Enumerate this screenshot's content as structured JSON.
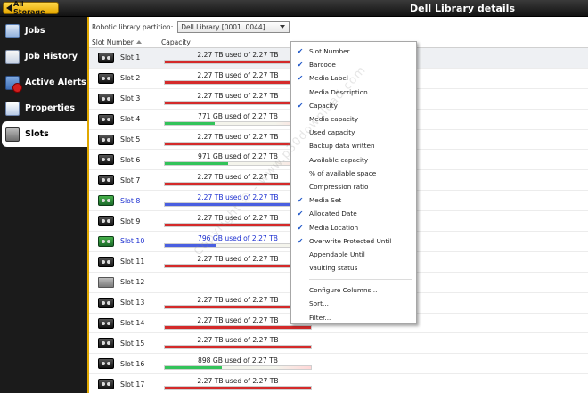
{
  "topbar": {
    "all_storage_label": "All Storage",
    "title": "Dell Library details"
  },
  "nav": {
    "items": [
      {
        "label": "Jobs",
        "icon": "jobs-icon"
      },
      {
        "label": "Job History",
        "icon": "job-history-icon"
      },
      {
        "label": "Active Alerts",
        "icon": "alert-icon"
      },
      {
        "label": "Properties",
        "icon": "properties-icon"
      },
      {
        "label": "Slots",
        "icon": "slots-icon",
        "active": true
      }
    ]
  },
  "toolbar": {
    "partition_label": "Robotic library partition:",
    "partition_value": "Dell Library [0001..0044]"
  },
  "columns": {
    "slot_number": "Slot Number",
    "capacity": "Capacity"
  },
  "rows": [
    {
      "slot": "Slot 1",
      "capacity": "2.27 TB used of 2.27 TB",
      "used_fraction": 1.0,
      "state": "full",
      "media": "tape"
    },
    {
      "slot": "Slot 2",
      "capacity": "2.27 TB used of 2.27 TB",
      "used_fraction": 1.0,
      "state": "full",
      "media": "tape"
    },
    {
      "slot": "Slot 3",
      "capacity": "2.27 TB used of 2.27 TB",
      "used_fraction": 1.0,
      "state": "full",
      "media": "tape"
    },
    {
      "slot": "Slot 4",
      "capacity": "771 GB used of 2.27 TB",
      "used_fraction": 0.34,
      "state": "partial",
      "media": "tape"
    },
    {
      "slot": "Slot 5",
      "capacity": "2.27 TB used of 2.27 TB",
      "used_fraction": 1.0,
      "state": "full",
      "media": "tape"
    },
    {
      "slot": "Slot 6",
      "capacity": "971 GB used of 2.27 TB",
      "used_fraction": 0.43,
      "state": "partial",
      "media": "tape"
    },
    {
      "slot": "Slot 7",
      "capacity": "2.27 TB used of 2.27 TB",
      "used_fraction": 1.0,
      "state": "full",
      "media": "tape"
    },
    {
      "slot": "Slot 8",
      "capacity": "2.27 TB used of 2.27 TB",
      "used_fraction": 1.0,
      "state": "online",
      "media": "tape-online"
    },
    {
      "slot": "Slot 9",
      "capacity": "2.27 TB used of 2.27 TB",
      "used_fraction": 1.0,
      "state": "full",
      "media": "tape"
    },
    {
      "slot": "Slot 10",
      "capacity": "796 GB used of 2.27 TB",
      "used_fraction": 0.35,
      "state": "online",
      "media": "tape-online"
    },
    {
      "slot": "Slot 11",
      "capacity": "2.27 TB used of 2.27 TB",
      "used_fraction": 1.0,
      "state": "full",
      "media": "tape"
    },
    {
      "slot": "Slot 12",
      "capacity": "",
      "used_fraction": 0,
      "state": "empty",
      "media": "empty"
    },
    {
      "slot": "Slot 13",
      "capacity": "2.27 TB used of 2.27 TB",
      "used_fraction": 1.0,
      "state": "full",
      "media": "tape"
    },
    {
      "slot": "Slot 14",
      "capacity": "2.27 TB used of 2.27 TB",
      "used_fraction": 1.0,
      "state": "full",
      "media": "tape"
    },
    {
      "slot": "Slot 15",
      "capacity": "2.27 TB used of 2.27 TB",
      "used_fraction": 1.0,
      "state": "full",
      "media": "tape"
    },
    {
      "slot": "Slot 16",
      "capacity": "898 GB used of 2.27 TB",
      "used_fraction": 0.39,
      "state": "partial",
      "media": "tape"
    },
    {
      "slot": "Slot 17",
      "capacity": "2.27 TB used of 2.27 TB",
      "used_fraction": 1.0,
      "state": "full",
      "media": "tape"
    }
  ],
  "context_menu": {
    "items": [
      {
        "label": "Slot Number",
        "checked": true
      },
      {
        "label": "Barcode",
        "checked": true
      },
      {
        "label": "Media Label",
        "checked": true
      },
      {
        "label": "Media Description",
        "checked": false
      },
      {
        "label": "Capacity",
        "checked": true
      },
      {
        "label": "Media capacity",
        "checked": false
      },
      {
        "label": "Used capacity",
        "checked": false
      },
      {
        "label": "Backup data written",
        "checked": false
      },
      {
        "label": "Available capacity",
        "checked": false
      },
      {
        "label": "% of available space",
        "checked": false
      },
      {
        "label": "Compression ratio",
        "checked": false
      },
      {
        "label": "Media Set",
        "checked": true
      },
      {
        "label": "Allocated Date",
        "checked": true
      },
      {
        "label": "Media Location",
        "checked": true
      },
      {
        "label": "Overwrite Protected Until",
        "checked": true
      },
      {
        "label": "Appendable Until",
        "checked": false
      },
      {
        "label": "Vaulting status",
        "checked": false
      }
    ],
    "actions": [
      {
        "label": "Configure Columns..."
      },
      {
        "label": "Sort..."
      },
      {
        "label": "Filter..."
      }
    ]
  },
  "colors": {
    "full_bar": "#d42a2a",
    "partial_bar": "#33c35a",
    "online_bar": "#4a5fe0",
    "accent": "#e0a800"
  },
  "watermark": "Copyright © - www.p30download.com"
}
